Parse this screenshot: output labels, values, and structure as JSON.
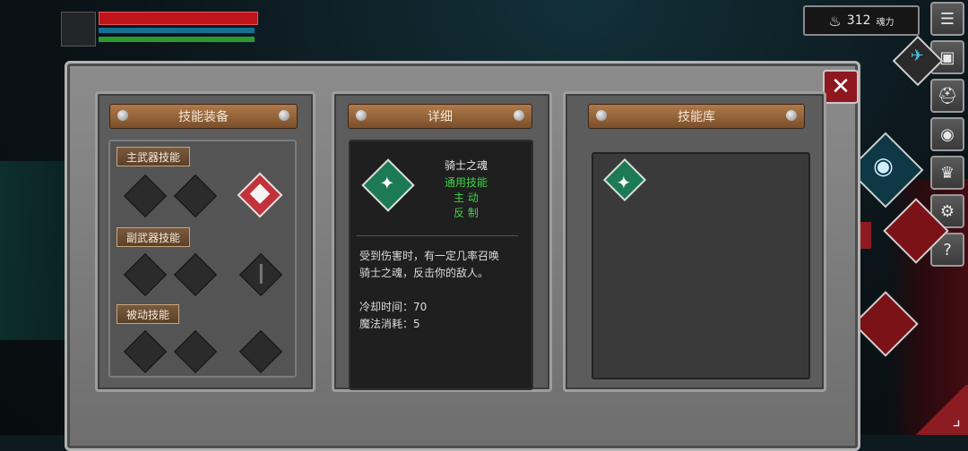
{
  "hud": {
    "soul_count": "312",
    "soul_label": "魂力"
  },
  "panels": {
    "equip_title": "技能装备",
    "detail_title": "详细",
    "library_title": "技能库"
  },
  "equip": {
    "main_weapon_label": "主武器技能",
    "sub_weapon_label": "副武器技能",
    "passive_label": "被动技能"
  },
  "detail": {
    "skill_name": "骑士之魂",
    "skill_type": "通用技能",
    "skill_mode": "主 动",
    "skill_tag": "反 制",
    "description_line1": "受到伤害时，有一定几率召唤",
    "description_line2": "骑士之魂，反击你的敌人。",
    "cooldown": "冷却时间：70",
    "mana_cost": "魔法消耗：5"
  },
  "icons": {
    "soul": "flame-icon",
    "menu": "list-icon",
    "backpack": "backpack-icon",
    "helmet": "helmet-icon",
    "emblem": "emblem-icon",
    "crown": "crown-icon",
    "settings": "gear-icon",
    "help": "question-icon",
    "close": "close-icon"
  },
  "colors": {
    "hp": "#c0141b",
    "mp": "#157094",
    "xp": "#2b9a2e",
    "skill_green": "#3fd24a"
  }
}
